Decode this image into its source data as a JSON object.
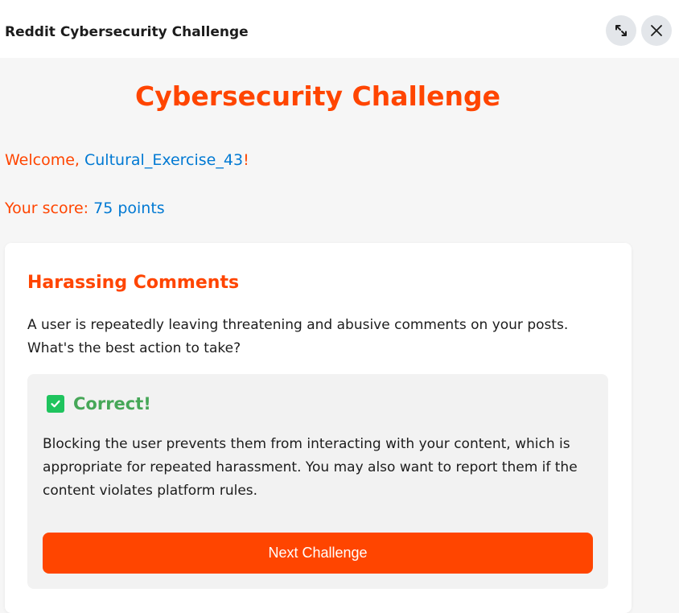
{
  "window": {
    "title": "Reddit Cybersecurity Challenge",
    "expand_icon": "expand-icon",
    "close_icon": "close-icon"
  },
  "main": {
    "title": "Cybersecurity Challenge",
    "welcome_prefix": "Welcome, ",
    "username": "Cultural_Exercise_43",
    "welcome_suffix": "!",
    "score_prefix": "Your score: ",
    "score_value": "75 points"
  },
  "challenge": {
    "title": "Harassing Comments",
    "question": "A user is repeatedly leaving threatening and abusive comments on your posts. What's the best action to take?",
    "feedback": {
      "icon": "check-icon",
      "status": "Correct!",
      "explanation": "Blocking the user prevents them from interacting with your content, which is appropriate for repeated harassment. You may also want to report them if the content violates platform rules.",
      "next_label": "Next Challenge"
    }
  },
  "colors": {
    "accent": "#ff4500",
    "link": "#0079d3",
    "success": "#46a758"
  }
}
